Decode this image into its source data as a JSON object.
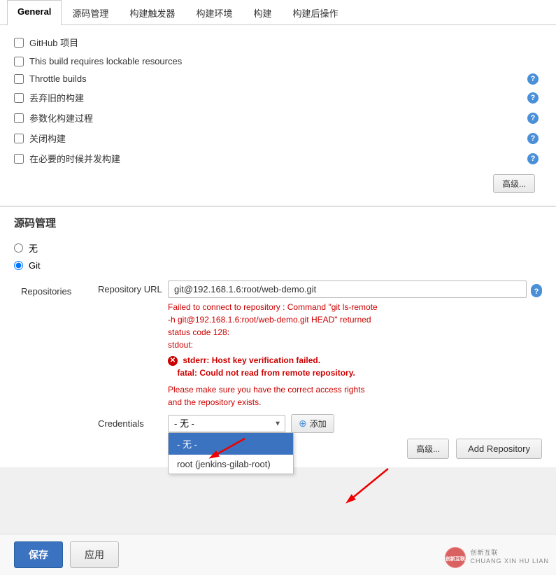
{
  "tabs": [
    {
      "id": "general",
      "label": "General",
      "active": true
    },
    {
      "id": "source",
      "label": "源码管理",
      "active": false
    },
    {
      "id": "trigger",
      "label": "构建触发器",
      "active": false
    },
    {
      "id": "env",
      "label": "构建环境",
      "active": false
    },
    {
      "id": "build",
      "label": "构建",
      "active": false
    },
    {
      "id": "post",
      "label": "构建后操作",
      "active": false
    }
  ],
  "general": {
    "checkboxes": [
      {
        "id": "github",
        "label": "GitHub 项目",
        "checked": false
      },
      {
        "id": "lockable",
        "label": "This build requires lockable resources",
        "checked": false
      },
      {
        "id": "throttle",
        "label": "Throttle builds",
        "checked": false,
        "hasHelp": true
      },
      {
        "id": "discard",
        "label": "丢弃旧的构建",
        "checked": false,
        "hasHelp": true
      },
      {
        "id": "param",
        "label": "参数化构建过程",
        "checked": false,
        "hasHelp": true
      },
      {
        "id": "disable",
        "label": "关闭构建",
        "checked": false,
        "hasHelp": true
      },
      {
        "id": "concurrent",
        "label": "在必要的时候并发构建",
        "checked": false,
        "hasHelp": true
      }
    ],
    "advanced_btn": "高级..."
  },
  "source_management": {
    "title": "源码管理",
    "none_label": "无",
    "git_label": "Git",
    "repos_label": "Repositories",
    "repo_url_label": "Repository URL",
    "repo_url_value": "git@192.168.1.6:root/web-demo.git",
    "repo_url_placeholder": "Repository URL",
    "error_line1": "Failed to connect to repository : Command \"git ls-remote",
    "error_line2": "-h git@192.168.1.6:root/web-demo.git HEAD\" returned",
    "error_line3": "status code 128:",
    "error_line4": "stdout:",
    "error_bold1": "stderr: Host key verification failed.",
    "error_bold2": "fatal: Could not read from remote repository.",
    "error_line5": "Please make sure you have the correct access rights",
    "error_line6": "and the repository exists.",
    "credentials_label": "Credentials",
    "credentials_value": "- 无 -",
    "dropdown_options": [
      {
        "value": "none",
        "label": "- 无 -",
        "selected": true
      },
      {
        "value": "root",
        "label": "root (jenkins-gilab-root)"
      }
    ],
    "add_credentials_btn": "添加",
    "advanced_btn": "高级...",
    "add_repo_btn": "Add Repository"
  },
  "bottom": {
    "save_label": "保存",
    "apply_label": "应用"
  },
  "watermark": {
    "brand": "创新互联",
    "sub": "CHUANG XIN HU LIAN"
  }
}
